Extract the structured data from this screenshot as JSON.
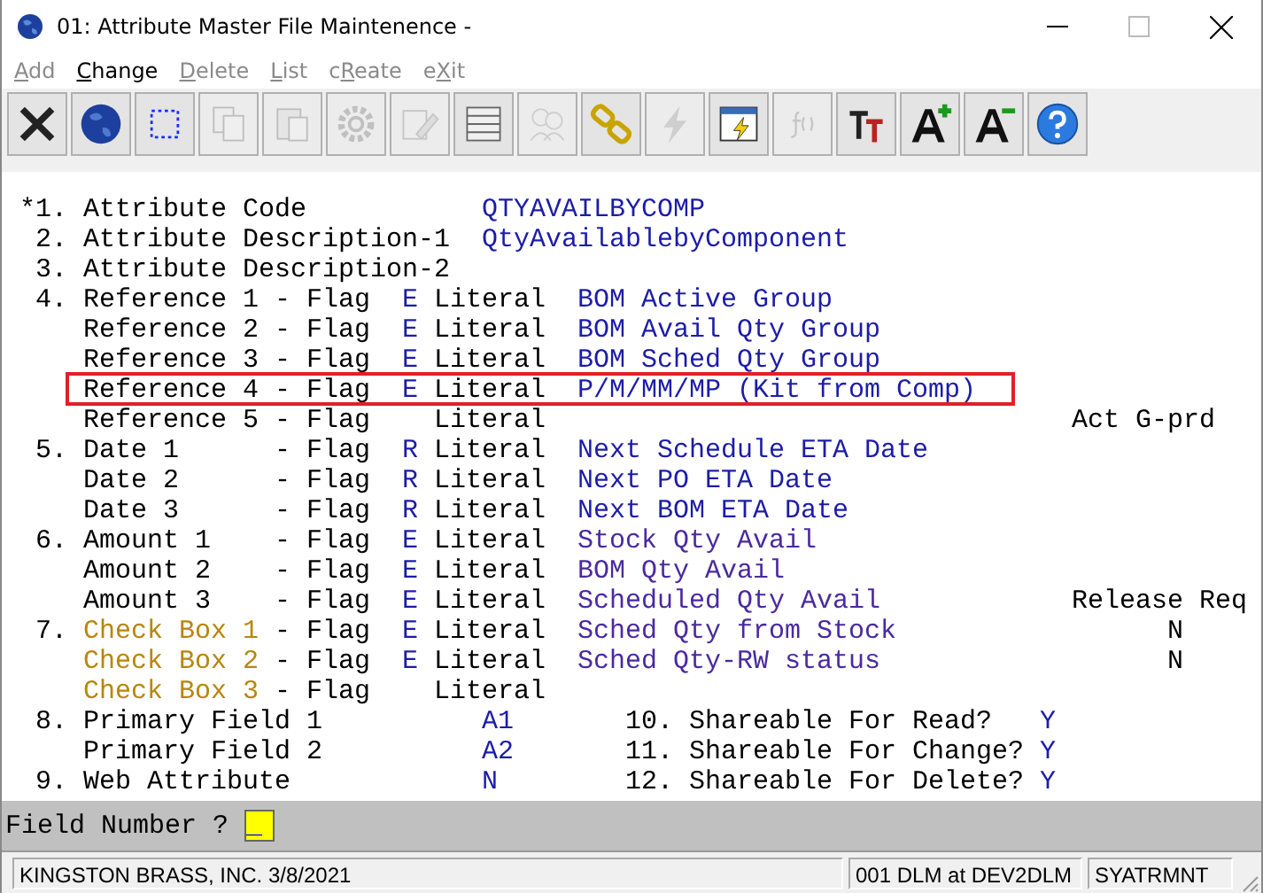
{
  "window": {
    "title": "01: Attribute Master File Maintenence -"
  },
  "menu": [
    {
      "key": "A",
      "post": "dd",
      "disabled": true
    },
    {
      "key": "C",
      "post": "hange",
      "disabled": false
    },
    {
      "key": "D",
      "post": "elete",
      "disabled": true
    },
    {
      "key": "L",
      "post": "ist",
      "disabled": true
    },
    {
      "pre": "c",
      "key": "R",
      "post": "eate",
      "disabled": true
    },
    {
      "pre": "e",
      "key": "X",
      "post": "it",
      "disabled": true
    }
  ],
  "toolbar": [
    {
      "disabled": false
    },
    {
      "disabled": false
    },
    {
      "disabled": false
    },
    {
      "disabled": true
    },
    {
      "disabled": true
    },
    {
      "disabled": true
    },
    {
      "disabled": true
    },
    {
      "disabled": false
    },
    {
      "disabled": true
    },
    {
      "disabled": false
    },
    {
      "disabled": true
    },
    {
      "disabled": false
    },
    {
      "disabled": true
    },
    {
      "disabled": false
    },
    {
      "disabled": false
    },
    {
      "disabled": false
    },
    {
      "disabled": false
    }
  ],
  "fields": [
    {
      "kind": "text",
      "number": "*1.",
      "label": "Attribute Code",
      "value": "QTYAVAILBYCOMP"
    },
    {
      "kind": "text",
      "number": "2.",
      "label": "Attribute Description-1",
      "value": "QtyAvailablebyComponent"
    },
    {
      "kind": "text",
      "number": "3.",
      "label": "Attribute Description-2"
    },
    {
      "kind": "reference",
      "number": "4.",
      "label": "Reference 1",
      "flag_label": "- Flag",
      "flag": "E",
      "literal": "Literal",
      "value": "BOM Active Group",
      "highlighted": false
    },
    {
      "kind": "reference",
      "label": "Reference 2",
      "flag_label": "- Flag",
      "flag": "E",
      "literal": "Literal",
      "value": "BOM Avail Qty Group",
      "highlighted": false
    },
    {
      "kind": "reference",
      "label": "Reference 3",
      "flag_label": "- Flag",
      "flag": "E",
      "literal": "Literal",
      "value": "BOM Sched Qty Group",
      "highlighted": false
    },
    {
      "kind": "reference",
      "label": "Reference 4",
      "flag_label": "- Flag",
      "flag": "E",
      "literal": "Literal",
      "value": "P/M/MM/MP (Kit from Comp)",
      "highlighted": true
    },
    {
      "kind": "reference",
      "label": "Reference 5",
      "flag_label": "- Flag",
      "literal": "Literal",
      "note": "Act G-prd",
      "highlighted": false
    },
    {
      "kind": "date",
      "number": "5.",
      "label": "Date 1",
      "flag_label": "- Flag",
      "flag": "R",
      "literal": "Literal",
      "value": "Next Schedule ETA Date",
      "highlighted": false
    },
    {
      "kind": "date",
      "label": "Date 2",
      "flag_label": "- Flag",
      "flag": "R",
      "literal": "Literal",
      "value": "Next PO ETA Date",
      "highlighted": false
    },
    {
      "kind": "date",
      "label": "Date 3",
      "flag_label": "- Flag",
      "flag": "R",
      "literal": "Literal",
      "value": "Next BOM ETA Date",
      "highlighted": false
    },
    {
      "kind": "amount",
      "number": "6.",
      "label": "Amount 1",
      "flag_label": "- Flag",
      "flag": "E",
      "literal": "Literal",
      "value": "Stock Qty Avail",
      "highlighted": false
    },
    {
      "kind": "amount",
      "label": "Amount 2",
      "flag_label": "- Flag",
      "flag": "E",
      "literal": "Literal",
      "value": "BOM Qty Avail",
      "highlighted": false
    },
    {
      "kind": "amount",
      "label": "Amount 3",
      "flag_label": "- Flag",
      "flag": "E",
      "literal": "Literal",
      "value": "Scheduled Qty Avail",
      "note": "Release Req",
      "highlighted": false
    },
    {
      "kind": "checkbox",
      "number": "7.",
      "label": "Check Box 1",
      "flag_label": "- Flag",
      "flag": "E",
      "literal": "Literal",
      "value": "Sched Qty from Stock",
      "release": "N",
      "highlighted": false
    },
    {
      "kind": "checkbox",
      "label": "Check Box 2",
      "flag_label": "- Flag",
      "flag": "E",
      "literal": "Literal",
      "value": "Sched Qty-RW status",
      "release": "N",
      "highlighted": false
    },
    {
      "kind": "checkbox",
      "label": "Check Box 3",
      "flag_label": "- Flag",
      "literal": "Literal",
      "highlighted": false
    },
    {
      "kind": "option",
      "number": "8.",
      "label": "Primary Field 1",
      "value": "A1",
      "option_number": "10.",
      "option_label": "Shareable For Read?",
      "option_value": "Y"
    },
    {
      "kind": "option",
      "label": "Primary Field 2",
      "value": "A2",
      "option_number": "11.",
      "option_label": "Shareable For Change?",
      "option_value": "Y"
    },
    {
      "kind": "option",
      "number": "9.",
      "label": "Web Attribute",
      "value": "N",
      "option_number": "12.",
      "option_label": "Shareable For Delete?",
      "option_value": "Y"
    }
  ],
  "prompt": {
    "label": "Field Number ?",
    "value": "_"
  },
  "status_bar": [
    "KINGSTON BRASS, INC. 3/8/2021",
    "001 DLM at DEV2DLM",
    "SYATRMNT"
  ]
}
